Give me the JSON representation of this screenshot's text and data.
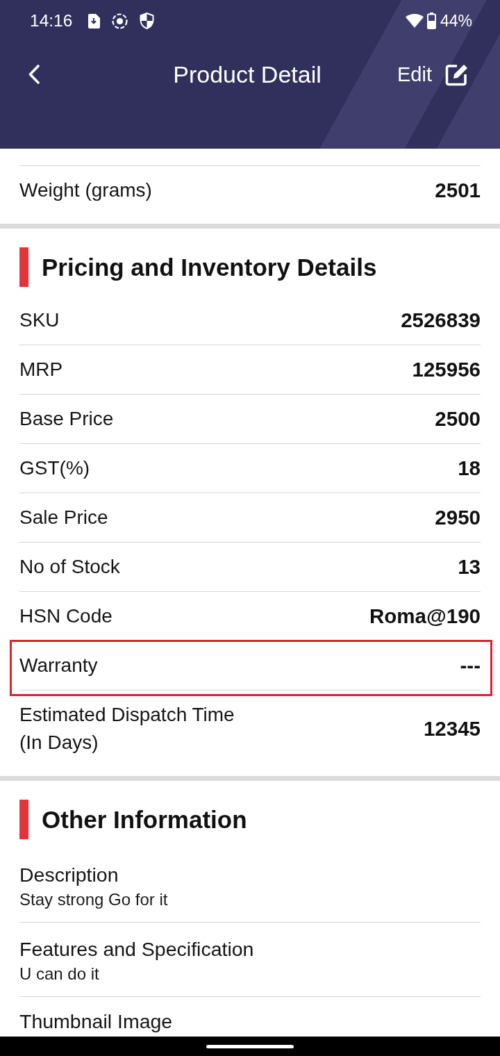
{
  "status_bar": {
    "time": "14:16",
    "battery": "44%"
  },
  "header": {
    "title": "Product Detail",
    "action": "Edit"
  },
  "sections": [
    {
      "kind": "pairs",
      "rows": [
        {
          "label": "Weight (grams)",
          "value": "2501",
          "highlighted": false
        }
      ]
    },
    {
      "kind": "pairs",
      "title": "Pricing and Inventory Details",
      "rows": [
        {
          "label": "SKU",
          "value": "2526839",
          "highlighted": false
        },
        {
          "label": "MRP",
          "value": "125956",
          "highlighted": false
        },
        {
          "label": "Base Price",
          "value": "2500",
          "highlighted": false
        },
        {
          "label": "GST(%)",
          "value": "18",
          "highlighted": false
        },
        {
          "label": "Sale Price",
          "value": "2950",
          "highlighted": false
        },
        {
          "label": "No of Stock",
          "value": "13",
          "highlighted": false
        },
        {
          "label": "HSN Code",
          "value": "Roma@190",
          "highlighted": false
        },
        {
          "label": "Warranty",
          "value": "---",
          "highlighted": true
        },
        {
          "label": "Estimated Dispatch Time (In Days)",
          "value": "12345",
          "highlighted": false
        }
      ]
    },
    {
      "kind": "stacked",
      "title": "Other Information",
      "rows": [
        {
          "label": "Description",
          "value": "Stay strong Go for it"
        },
        {
          "label": "Features and Specification",
          "value": "U can do it"
        },
        {
          "label": "Thumbnail Image"
        }
      ]
    }
  ]
}
